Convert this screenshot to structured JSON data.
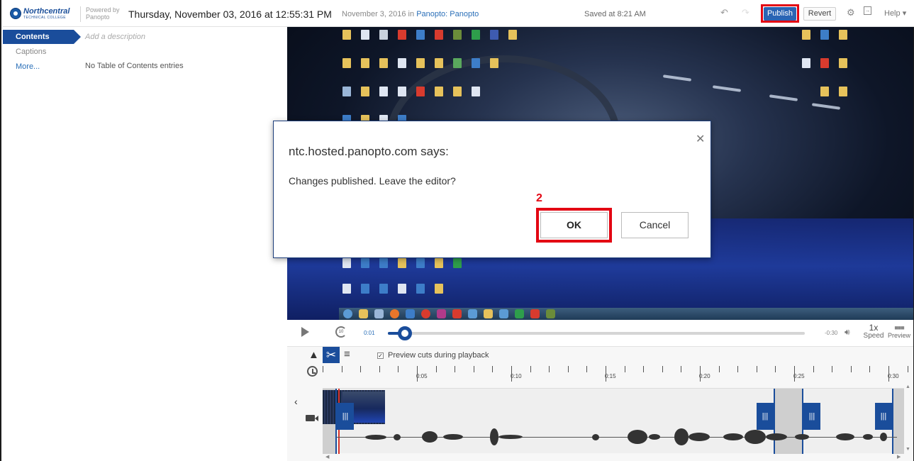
{
  "topbar": {
    "logo_name": "Northcentral",
    "logo_sub": "TECHNICAL COLLEGE",
    "powered_line1": "Powered by",
    "powered_line2": "Panopto",
    "session_title": "Thursday, November 03, 2016 at 12:55:31 PM",
    "session_date": "November 3, 2016 in",
    "session_folder": "Panopto: Panopto",
    "saved_status": "Saved at 8:21 AM",
    "publish_label": "Publish",
    "revert_label": "Revert",
    "help_label": "Help"
  },
  "sidebar": {
    "tabs": [
      {
        "label": "Contents"
      },
      {
        "label": "Captions"
      },
      {
        "label": "More..."
      }
    ],
    "description_placeholder": "Add a description",
    "empty_message": "No Table of Contents entries"
  },
  "player": {
    "current_time": "0:01",
    "remaining_time": "-0:30",
    "speed_value": "1x",
    "speed_label": "Speed",
    "preview_label": "Preview",
    "progress": 0.04
  },
  "editor": {
    "checkbox_label": "Preview cuts during playback",
    "checkbox_checked": true
  },
  "timeline": {
    "tick_labels": [
      "0:05",
      "0:10",
      "0:15",
      "0:20",
      "0:25",
      "0:30"
    ]
  },
  "dialog": {
    "title": "ntc.hosted.panopto.com says:",
    "message": "Changes published. Leave the editor?",
    "ok_label": "OK",
    "cancel_label": "Cancel",
    "step_callout": "2"
  },
  "colors": {
    "accent": "#1a4d9b",
    "highlight": "#e30613",
    "link": "#2a6fb8"
  },
  "icons": {
    "undo": "undo-icon",
    "redo": "redo-icon",
    "settings": "gear-icon",
    "share": "share-icon",
    "play": "play-icon",
    "replay": "replay-10-icon",
    "volume": "volume-icon",
    "clock": "clock-icon",
    "camera": "camera-icon",
    "cut": "scissors-icon"
  }
}
